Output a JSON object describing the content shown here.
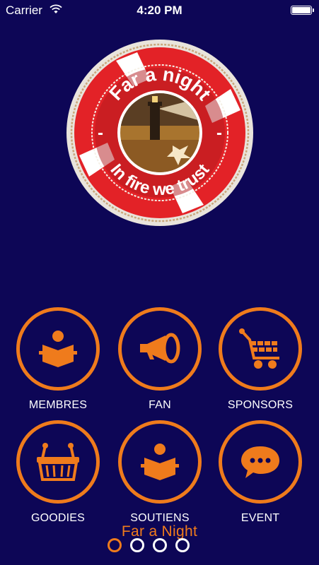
{
  "status_bar": {
    "carrier": "Carrier",
    "time": "4:20 PM"
  },
  "logo": {
    "arc_top": "Far a night",
    "arc_bottom": "In fire we trust",
    "dash": "-"
  },
  "menu": [
    {
      "label": "MEMBRES",
      "icon": "reader-icon"
    },
    {
      "label": "FAN",
      "icon": "megaphone-icon"
    },
    {
      "label": "SPONSORS",
      "icon": "shopping-cart-icon"
    },
    {
      "label": "GOODIES",
      "icon": "basket-icon"
    },
    {
      "label": "SOUTIENS",
      "icon": "reader-icon"
    },
    {
      "label": "EVENT",
      "icon": "chat-bubble-icon"
    }
  ],
  "footer": {
    "brand": "Far a Night"
  },
  "pager": {
    "pages": 4,
    "current": 1
  },
  "colors": {
    "background": "#0d0656",
    "accent": "#ef7b1c",
    "ring_red": "#e32227"
  }
}
